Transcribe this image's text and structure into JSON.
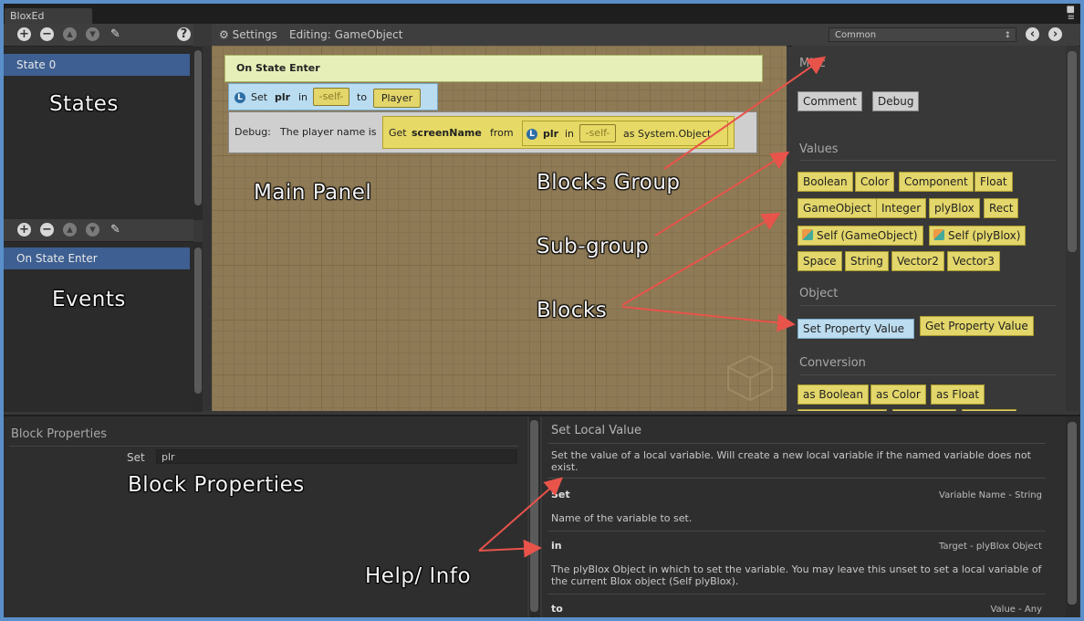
{
  "window": {
    "tab_title": "BloxEd"
  },
  "toolbar": {
    "settings_label": "Settings",
    "editing_label": "Editing: GameObject",
    "group_select": "Common"
  },
  "states_panel": {
    "items": [
      "State 0"
    ],
    "annotation": "States"
  },
  "events_panel": {
    "items": [
      "On State Enter"
    ],
    "annotation": "Events"
  },
  "canvas": {
    "annotation": "Main Panel",
    "event_header": "On State Enter",
    "set_block": {
      "set": "Set",
      "var": "plr",
      "in": "in",
      "target": "-self-",
      "to": "to",
      "value": "Player"
    },
    "debug_block": {
      "label": "Debug:",
      "text": "The player name is",
      "get": "Get",
      "prop": "screenName",
      "from": "from",
      "var": "plr",
      "in": "in",
      "target": "-self-",
      "as": "as System.Object"
    }
  },
  "blocks_panel": {
    "groups": [
      {
        "name": "Misc",
        "blocks": [
          "Comment",
          "Debug"
        ]
      },
      {
        "name": "Values",
        "blocks": [
          "Boolean",
          "Color",
          "Component",
          "Float",
          "GameObject",
          "Integer",
          "plyBlox",
          "Rect",
          "Self (GameObject)",
          "Self (plyBlox)",
          "Space",
          "String",
          "Vector2",
          "Vector3"
        ]
      },
      {
        "name": "Object",
        "blocks": [
          "Set Property Value",
          "Get Property Value"
        ]
      },
      {
        "name": "Conversion",
        "blocks": [
          "as Boolean",
          "as Color",
          "as Float"
        ]
      }
    ]
  },
  "annotations": {
    "blocks_group": "Blocks Group",
    "sub_group": "Sub-group",
    "blocks": "Blocks",
    "block_properties": "Block Properties",
    "help_info": "Help/ Info"
  },
  "block_properties": {
    "title": "Block Properties",
    "field_label": "Set",
    "field_value": "plr"
  },
  "help": {
    "title": "Set Local Value",
    "description": "Set the value of a local variable. Will create a new local variable if the named variable does not exist.",
    "params": [
      {
        "name": "Set",
        "type": "Variable Name - String",
        "desc": "Name of the variable to set."
      },
      {
        "name": "in",
        "type": "Target - plyBlox Object",
        "desc": "The plyBlox Object in which to set the variable. You may leave this unset to set a local variable of the current Blox object (Self plyBlox)."
      },
      {
        "name": "to",
        "type": "Value - Any",
        "desc": ""
      }
    ]
  },
  "colors": {
    "accent": "#3d5f92",
    "block_yellow": "#e3d66a",
    "block_grey": "#cfcfcf",
    "block_blue": "#bcdcef",
    "arrow": "#e8534a",
    "frame": "#5a8fc9"
  }
}
